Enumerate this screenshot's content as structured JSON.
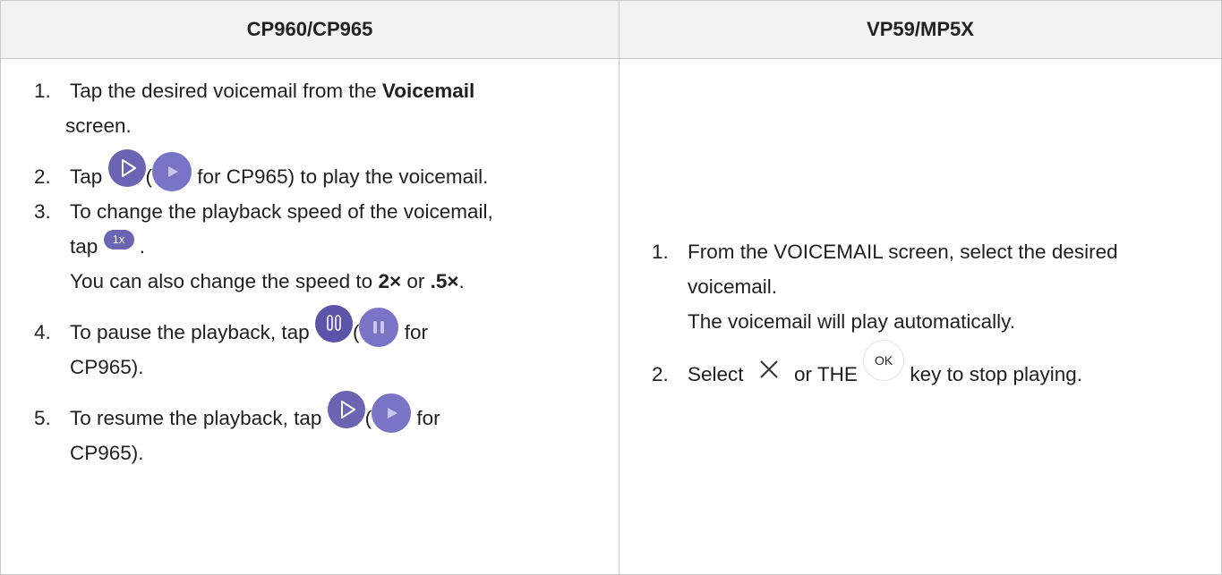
{
  "columns": [
    "CP960/CP965",
    "VP59/MP5X"
  ],
  "left": {
    "steps": [
      {
        "num": "1.",
        "pre": "Tap the desired voicemail from the ",
        "bold": "Voicemail",
        "post": " screen."
      },
      {
        "num": "2.",
        "pre": "Tap ",
        "mid": "(",
        "post": " for CP965) to play the voicemail."
      },
      {
        "num": "3.",
        "line1": "To change the playback speed of the voicemail,",
        "line2_pre": "tap ",
        "line2_post": " .",
        "line3_pre": "You can also change the speed to ",
        "speed_a": "2×",
        "line3_mid": " or ",
        "speed_b": ".5×",
        "line3_post": "."
      },
      {
        "num": "4.",
        "pre": "To pause the playback, tap ",
        "mid": "(",
        "post": " for",
        "line2": "CP965)."
      },
      {
        "num": "5.",
        "pre": "To resume the playback, tap ",
        "mid": "(",
        "post": " for",
        "line2": "CP965)."
      }
    ],
    "speed_pill": "1x"
  },
  "right": {
    "steps": [
      {
        "num": "1.",
        "line1": "From the VOICEMAIL screen, select the desired",
        "line2": "voicemail.",
        "line3": "The voicemail will play automatically."
      },
      {
        "num": "2.",
        "pre": "Select ",
        "mid": " or THE ",
        "post": " key to stop playing."
      }
    ],
    "ok_key": "OK"
  },
  "icons": [
    "play-outline-icon",
    "play-solid-icon",
    "speed-1x-icon",
    "pause-icon",
    "pause-solid-icon",
    "close-x-icon",
    "ok-key-icon"
  ],
  "colors": {
    "accent": "#6a64b2",
    "header_bg": "#f2f2f2",
    "border": "#c9c9c9"
  }
}
